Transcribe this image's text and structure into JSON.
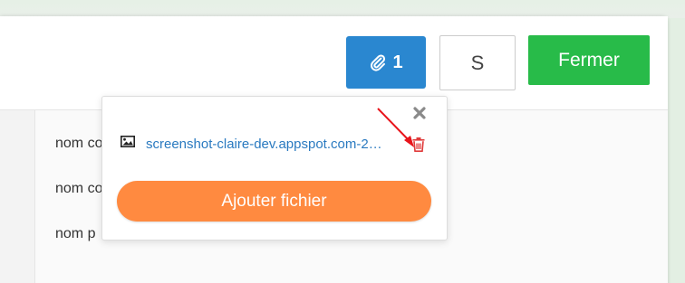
{
  "header": {
    "attach_button": {
      "count": "1",
      "icon": "paperclip-icon"
    },
    "s_button_label": "S",
    "close_button_label": "Fermer"
  },
  "body": {
    "fields": [
      {
        "label": "nom co"
      },
      {
        "label": "nom co"
      },
      {
        "label": "nom p"
      }
    ]
  },
  "attachments_popover": {
    "files": [
      {
        "name": "screenshot-claire-dev.appspot.com-2…",
        "icon": "image-icon"
      }
    ],
    "add_file_label": "Ajouter fichier",
    "close_icon": "close-icon",
    "delete_icon": "trash-icon"
  },
  "colors": {
    "attach_blue": "#2a87d0",
    "close_green": "#28bb49",
    "add_orange": "#ff8a40",
    "link_blue": "#2a7ac0",
    "trash_red": "#e03a3a",
    "arrow_red": "#e8141b"
  }
}
